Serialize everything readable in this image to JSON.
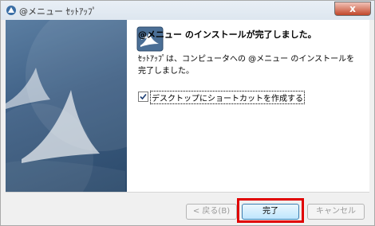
{
  "window": {
    "title": "@メニュー ｾｯﾄｱｯﾌﾟ",
    "close_glyph": "x"
  },
  "page": {
    "heading": "@メニュー のインストールが完了しました。",
    "message": "ｾｯﾄｱｯﾌﾟは、コンピュータへの @メニュー のインストールを完了しました。",
    "checkbox": {
      "label": "デスクトップにショートカットを作成する",
      "checked": true
    }
  },
  "buttons": {
    "back": "< 戻る(B)",
    "finish": "完了",
    "cancel": "キャンセル"
  },
  "colors": {
    "side_panel": "#3e5f84",
    "highlight": "#e00000"
  }
}
